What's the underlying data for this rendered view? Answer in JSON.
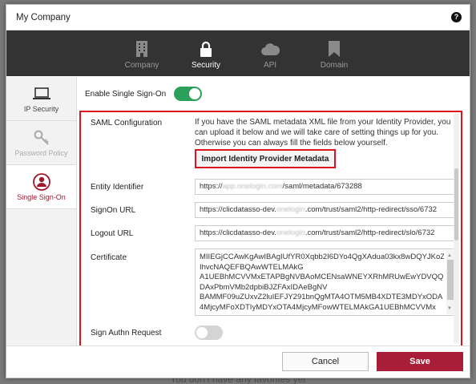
{
  "window": {
    "title": "My Company"
  },
  "backdrop": {
    "text": "You don't have any favorites yet"
  },
  "topnav": [
    {
      "label": "Company",
      "icon": "building-icon",
      "active": false
    },
    {
      "label": "Security",
      "icon": "lock-icon",
      "active": true
    },
    {
      "label": "API",
      "icon": "cloud-icon",
      "active": false
    },
    {
      "label": "Domain",
      "icon": "bookmark-icon",
      "active": false
    }
  ],
  "sidebar": [
    {
      "label": "IP Security",
      "icon": "laptop-icon",
      "state": "normal"
    },
    {
      "label": "Password Policy",
      "icon": "key-icon",
      "state": "disabled"
    },
    {
      "label": "Single Sign-On",
      "icon": "user-circle-icon",
      "state": "active"
    }
  ],
  "sso": {
    "toggle_label": "Enable Single Sign-On",
    "enabled": true
  },
  "saml": {
    "section_label": "SAML Configuration",
    "description": "If you have the SAML metadata XML file from your Identity Provider, you can upload it below and we will take care of setting things up for you. Otherwise you can always fill the fields below yourself.",
    "import_button": "Import Identity Provider Metadata",
    "entity_identifier": {
      "label": "Entity Identifier",
      "value_prefix": "https://",
      "value_blurred": "app.onelogin.com",
      "value_suffix": "/saml/metadata/673288"
    },
    "signon_url": {
      "label": "SignOn URL",
      "value_prefix": "https://clicdatasso-dev.",
      "value_blurred": "onelogin",
      "value_suffix": ".com/trust/saml2/http-redirect/sso/6732"
    },
    "logout_url": {
      "label": "Logout URL",
      "value_prefix": "https://clicdatasso-dev.",
      "value_blurred": "onelogin",
      "value_suffix": ".com/trust/saml2/http-redirect/slo/6732"
    },
    "certificate": {
      "label": "Certificate",
      "lines": [
        "MIIEGjCCAwKgAwIBAgIUfYR0Xqbb2I6DYo4QgXAdua03kx8wDQYJKoZ",
        "IhvcNAQEFBQAwWTELMAkG",
        "A1UEBhMCVVMxETAPBgNVBAoMCENsaWNEYXRhMRUwEwYDVQQL",
        "DAxPbmVMb2dpbiBJZFAxIDAeBgNV",
        "BAMMF09uZUxvZ2luIEFJY291bnQgMTA4OTM5MB4XDTE3MDYxODA",
        "4MjcyMFoXDTIyMDYxOTA4MjcyMFowWTELMAkGA1UEBhMCVVMx"
      ]
    },
    "sign_authn": {
      "label": "Sign Authn Request",
      "enabled": false
    }
  },
  "footer": {
    "cancel_label": "Cancel",
    "save_label": "Save"
  },
  "colors": {
    "accent": "#a81d38",
    "toggle_on": "#2ba05a",
    "highlight_border": "#d9141f",
    "nav_bg": "#333333"
  }
}
